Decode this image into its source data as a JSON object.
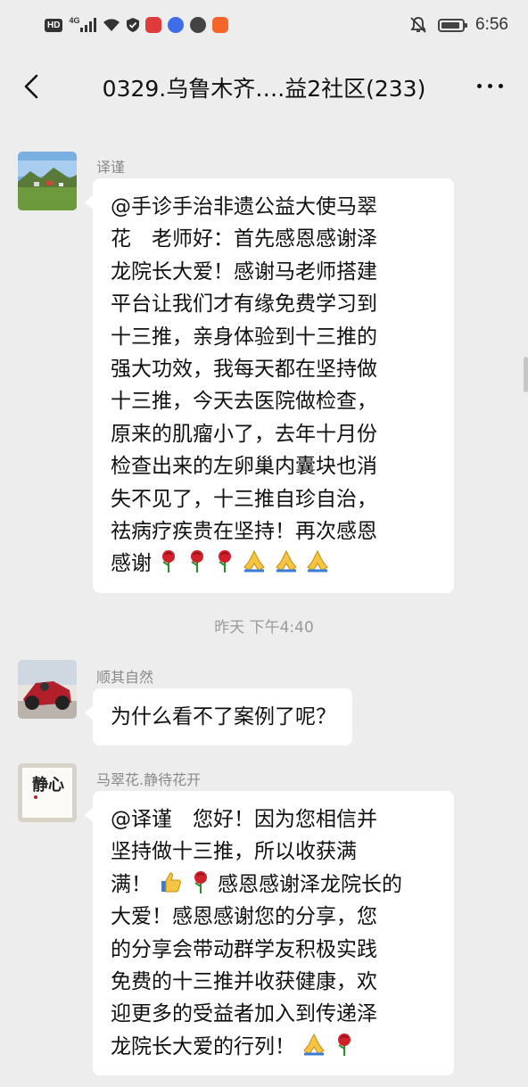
{
  "status_bar": {
    "hd": "HD",
    "network": "4G",
    "time": "6:56"
  },
  "header": {
    "title": "0329.乌鲁木齐….益2社区(233)"
  },
  "messages": [
    {
      "sender": "译谨",
      "lines": [
        "@手诊手治非遗公益大使马翠",
        "花　老师好：首先感恩感谢泽",
        "龙院长大爱！感谢马老师搭建",
        "平台让我们才有缘免费学习到",
        "十三推，亲身体验到十三推的",
        "强大功效，我每天都在坚持做",
        "十三推，今天去医院做检查，",
        "原来的肌瘤小了，去年十月份",
        "检查出来的左卵巢内囊块也消",
        "失不见了，十三推自珍自治，",
        "祛病疗疾贵在坚持！再次感恩",
        "感谢"
      ],
      "emoji": [
        "rose-emoji",
        "rose-emoji",
        "rose-emoji",
        "pray-emoji",
        "pray-emoji",
        "pray-emoji"
      ]
    },
    {
      "sender": "顺其自然",
      "lines": [
        "为什么看不了案例了呢？"
      ]
    },
    {
      "sender": "马翠花.静待花开",
      "avatar_text": "静心",
      "lines": [
        "@译谨　您好！因为您相信并",
        "坚持做十三推，所以收获满",
        "满！",
        "感恩感谢泽龙院长的",
        "大爱！感恩感谢您的分享，您",
        "的分享会带动群学友积极实践",
        "免费的十三推并收获健康，欢",
        "迎更多的受益者加入到传递泽",
        "龙院长大爱的行列！"
      ]
    }
  ],
  "timestamp": "昨天 下午4:40",
  "colors": {
    "background": "#ededed",
    "bubble": "#ffffff",
    "sender_name": "#8a8a8a",
    "rose": "#d0202a",
    "pray": "#f5c542"
  }
}
